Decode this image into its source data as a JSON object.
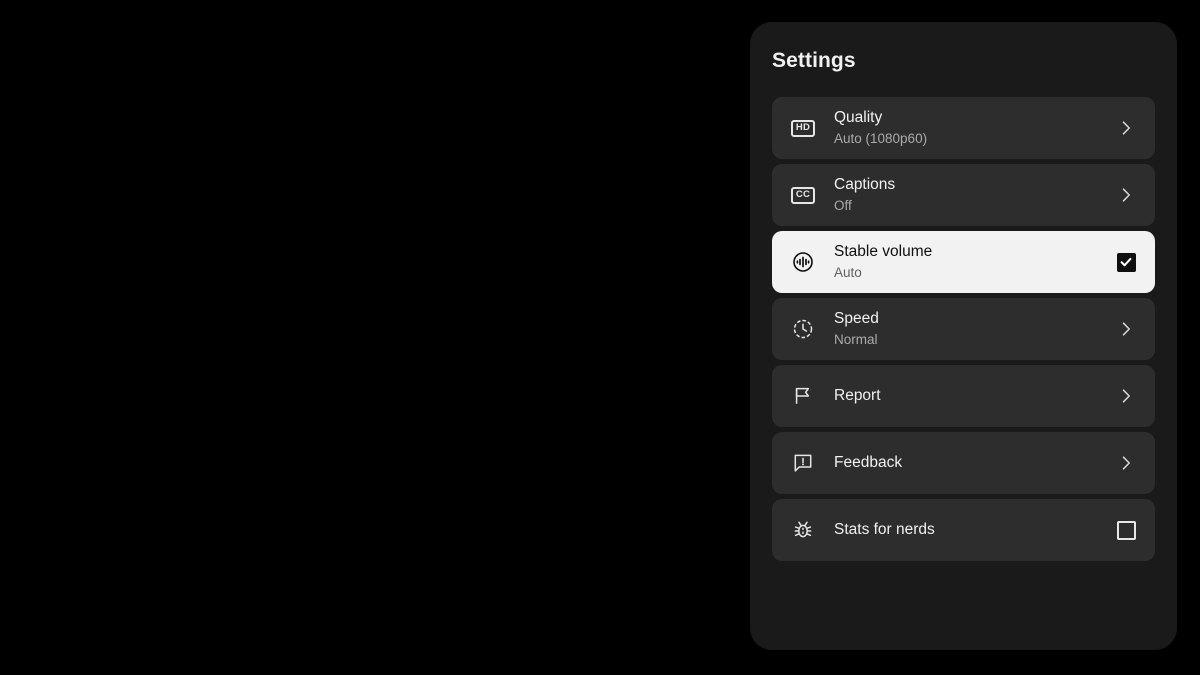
{
  "panel": {
    "title": "Settings",
    "background": "#1a1a1a",
    "row_background": "#2d2d2d",
    "selected_row_background": "#f2f2f2",
    "text_color": "#f1f1f1",
    "secondary_text_color": "#aaaaaa"
  },
  "rows": [
    {
      "icon": "hd-icon",
      "icon_text": "HD",
      "label": "Quality",
      "value": "Auto (1080p60)",
      "trailing": "chevron-right-icon",
      "selected": false
    },
    {
      "icon": "cc-icon",
      "icon_text": "CC",
      "label": "Captions",
      "value": "Off",
      "trailing": "chevron-right-icon",
      "selected": false
    },
    {
      "icon": "stable-volume-icon",
      "icon_text": "",
      "label": "Stable volume",
      "value": "Auto",
      "trailing": "checkbox-checked",
      "selected": true
    },
    {
      "icon": "clock-icon",
      "icon_text": "",
      "label": "Speed",
      "value": "Normal",
      "trailing": "chevron-right-icon",
      "selected": false
    },
    {
      "icon": "flag-icon",
      "icon_text": "",
      "label": "Report",
      "value": "",
      "trailing": "chevron-right-icon",
      "selected": false
    },
    {
      "icon": "feedback-icon",
      "icon_text": "",
      "label": "Feedback",
      "value": "",
      "trailing": "chevron-right-icon",
      "selected": false
    },
    {
      "icon": "bug-icon",
      "icon_text": "",
      "label": "Stats for nerds",
      "value": "",
      "trailing": "checkbox-unchecked",
      "selected": false
    }
  ]
}
